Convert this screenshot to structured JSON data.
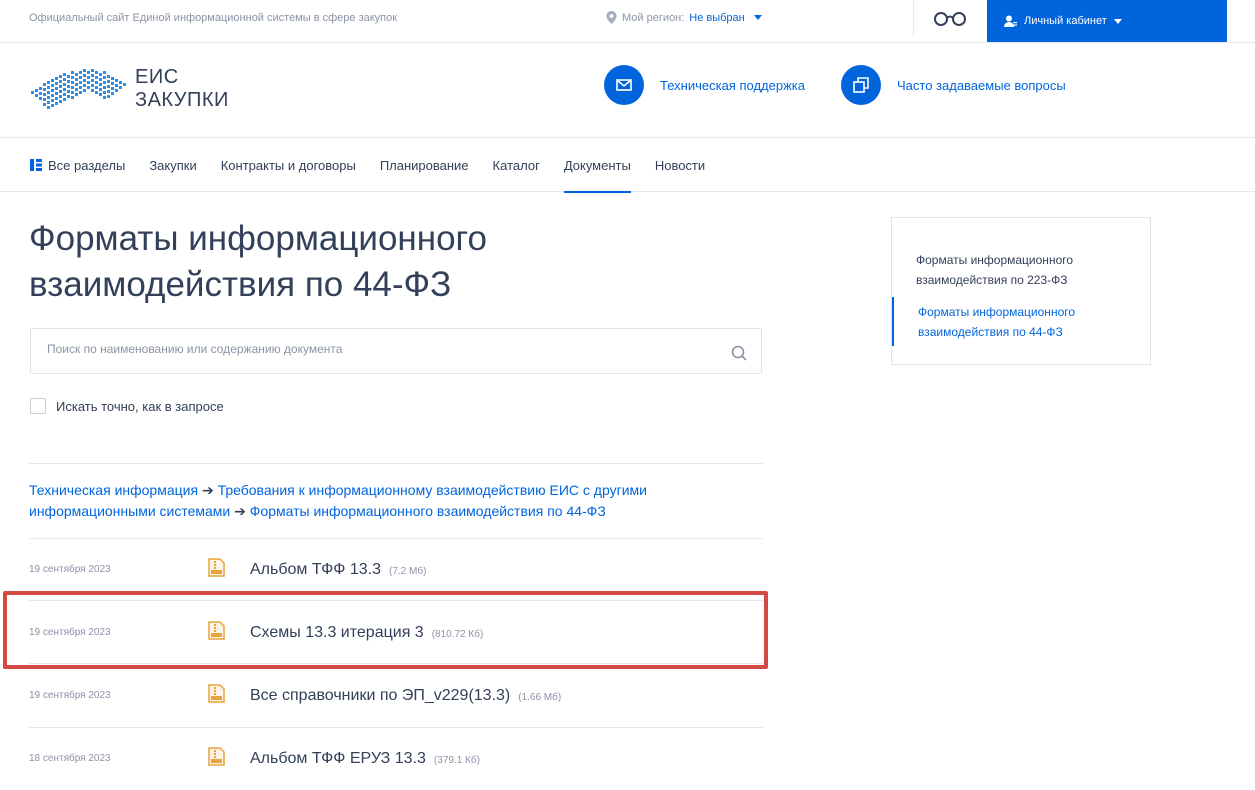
{
  "topbar": {
    "official_site": "Официальный сайт Единой информационной системы в сфере закупок",
    "region_label": "Мой регион:",
    "region_value": "Не выбран",
    "cabinet_label": "Личный кабинет"
  },
  "header": {
    "logo_line1": "ЕИС",
    "logo_line2": "ЗАКУПКИ",
    "support_label": "Техническая поддержка",
    "faq_label": "Часто задаваемые вопросы"
  },
  "nav": {
    "items": [
      "Все разделы",
      "Закупки",
      "Контракты и договоры",
      "Планирование",
      "Каталог",
      "Документы",
      "Новости"
    ],
    "active": "Документы"
  },
  "main": {
    "title": "Форматы информационного взаимодействия по 44-ФЗ",
    "search_placeholder": "Поиск по наименованию или содержанию документа",
    "exact_label": "Искать точно, как в запросе",
    "breadcrumb": {
      "c1": "Техническая информация",
      "c2": "Требования к информационному взаимодействию ЕИС с другими информационными системами",
      "c3": "Форматы информационного взаимодействия по 44-ФЗ",
      "arrow": "➔"
    },
    "documents": [
      {
        "date": "19 сентября 2023",
        "name": "Альбом ТФФ 13.3",
        "size": "(7.2 Мб)"
      },
      {
        "date": "19 сентября 2023",
        "name": "Схемы 13.3 итерация 3",
        "size": "(810.72 Кб)"
      },
      {
        "date": "19 сентября 2023",
        "name": "Все справочники по ЭП_v229(13.3)",
        "size": "(1.66 Мб)"
      },
      {
        "date": "18 сентября 2023",
        "name": "Альбом ТФФ ЕРУЗ 13.3",
        "size": "(379.1 Кб)"
      }
    ]
  },
  "side": {
    "item1": "Форматы информационного взаимодействия по 223-ФЗ",
    "item2": "Форматы информационного взаимодействия по 44-ФЗ"
  },
  "colors": {
    "accent": "#0065dd",
    "text": "#334059",
    "muted": "#8a93a6",
    "highlight": "#d24a42",
    "file_icon": "#e8a33d"
  }
}
